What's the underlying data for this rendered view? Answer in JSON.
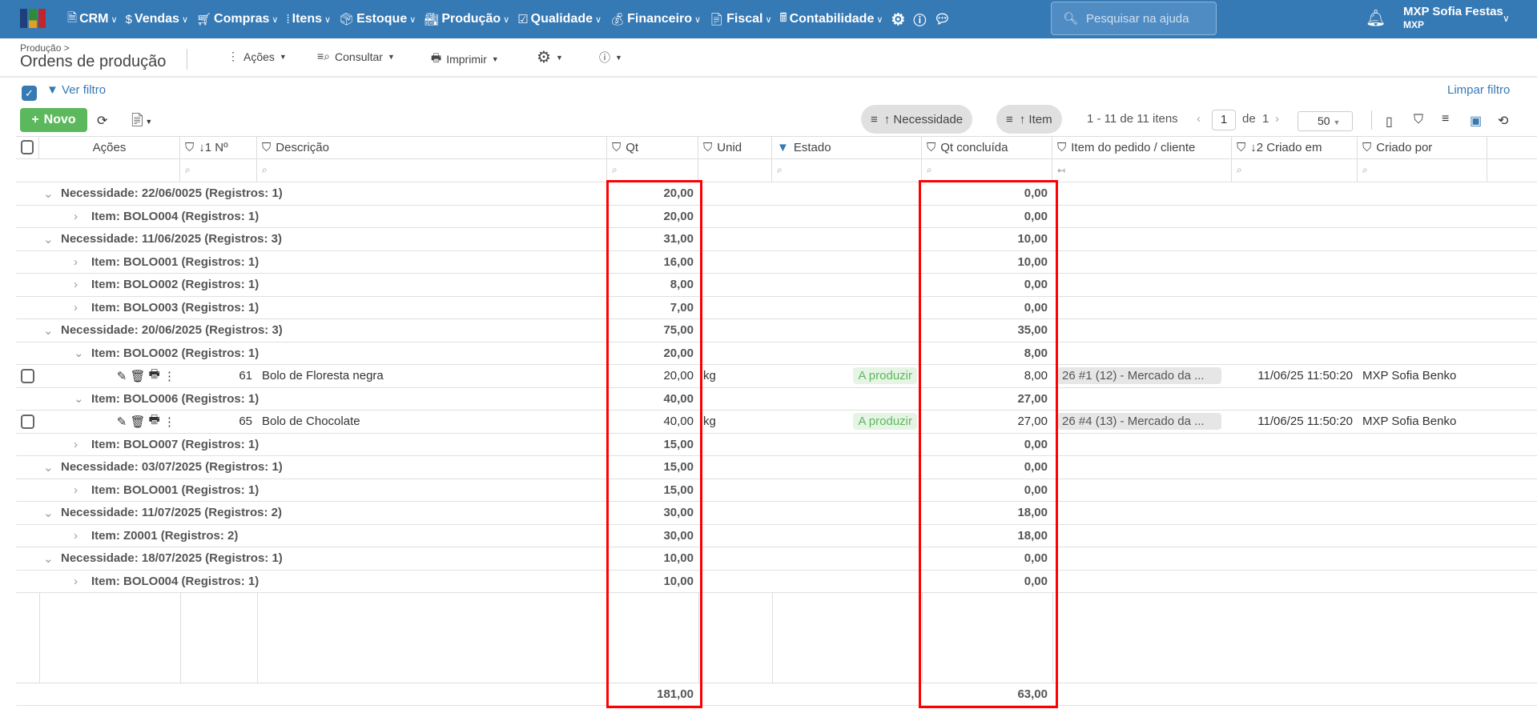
{
  "nav": {
    "items": [
      "CRM",
      "Vendas",
      "Compras",
      "Itens",
      "Estoque",
      "Produção",
      "Qualidade",
      "Financeiro",
      "Fiscal",
      "Contabilidade"
    ],
    "search_placeholder": "Pesquisar na ajuda",
    "user_name": "MXP Sofia Festas",
    "user_company": "MXP"
  },
  "page": {
    "breadcrumb": "Produção >",
    "title": "Ordens de produção",
    "actions": "Ações",
    "consultar": "Consultar",
    "imprimir": "Imprimir"
  },
  "filter": {
    "ver_filtro": "Ver filtro",
    "limpar_filtro": "Limpar filtro"
  },
  "toolbar": {
    "novo": "Novo",
    "group_necessidade": "↑ Necessidade",
    "group_item": "↑ Item",
    "range": "1 - 11 de 11 itens",
    "page": "1",
    "of": "de",
    "total_pages": "1",
    "page_size": "50"
  },
  "columns": [
    "Ações",
    "↓1  Nº",
    "Descrição",
    "Qt",
    "Unid",
    "Estado",
    "Qt concluída",
    "Item do pedido / cliente",
    "↓2  Criado em",
    "Criado por"
  ],
  "rows": [
    {
      "t": "g1",
      "label": "Necessidade: 22/06/0025 (Registros: 1)",
      "qt": "20,00",
      "qtc": "0,00"
    },
    {
      "t": "g2",
      "label": "Item: BOLO004 (Registros: 1)",
      "qt": "20,00",
      "qtc": "0,00"
    },
    {
      "t": "g1",
      "label": "Necessidade: 11/06/2025 (Registros: 3)",
      "qt": "31,00",
      "qtc": "10,00"
    },
    {
      "t": "g2",
      "label": "Item: BOLO001 (Registros: 1)",
      "qt": "16,00",
      "qtc": "10,00"
    },
    {
      "t": "g2",
      "label": "Item: BOLO002 (Registros: 1)",
      "qt": "8,00",
      "qtc": "0,00"
    },
    {
      "t": "g2",
      "label": "Item: BOLO003 (Registros: 1)",
      "qt": "7,00",
      "qtc": "0,00"
    },
    {
      "t": "g1",
      "label": "Necessidade: 20/06/2025 (Registros: 3)",
      "qt": "75,00",
      "qtc": "35,00"
    },
    {
      "t": "g2o",
      "label": "Item: BOLO002 (Registros: 1)",
      "qt": "20,00",
      "qtc": "8,00"
    },
    {
      "t": "d",
      "num": "61",
      "desc": "Bolo de Floresta negra",
      "qt": "20,00",
      "unid": "kg",
      "estado": "A produzir",
      "qtc": "8,00",
      "pedido": "26 #1 (12) - Mercado da ...",
      "criado_em": "11/06/25 11:50:20",
      "criado_por": "MXP Sofia Benko"
    },
    {
      "t": "g2o",
      "label": "Item: BOLO006 (Registros: 1)",
      "qt": "40,00",
      "qtc": "27,00"
    },
    {
      "t": "d",
      "num": "65",
      "desc": "Bolo de Chocolate",
      "qt": "40,00",
      "unid": "kg",
      "estado": "A produzir",
      "qtc": "27,00",
      "pedido": "26 #4 (13) - Mercado da ...",
      "criado_em": "11/06/25 11:50:20",
      "criado_por": "MXP Sofia Benko"
    },
    {
      "t": "g2",
      "label": "Item: BOLO007 (Registros: 1)",
      "qt": "15,00",
      "qtc": "0,00"
    },
    {
      "t": "g1",
      "label": "Necessidade: 03/07/2025 (Registros: 1)",
      "qt": "15,00",
      "qtc": "0,00"
    },
    {
      "t": "g2",
      "label": "Item: BOLO001 (Registros: 1)",
      "qt": "15,00",
      "qtc": "0,00"
    },
    {
      "t": "g1",
      "label": "Necessidade: 11/07/2025 (Registros: 2)",
      "qt": "30,00",
      "qtc": "18,00"
    },
    {
      "t": "g2",
      "label": "Item: Z0001 (Registros: 2)",
      "qt": "30,00",
      "qtc": "18,00"
    },
    {
      "t": "g1",
      "label": "Necessidade: 18/07/2025 (Registros: 1)",
      "qt": "10,00",
      "qtc": "0,00"
    },
    {
      "t": "g2",
      "label": "Item: BOLO004 (Registros: 1)",
      "qt": "10,00",
      "qtc": "0,00"
    }
  ],
  "totals": {
    "qt": "181,00",
    "qtc": "63,00"
  },
  "colors": {
    "brand": "#3579b5",
    "highlight": "#ff0000",
    "success": "#5cb85c"
  }
}
